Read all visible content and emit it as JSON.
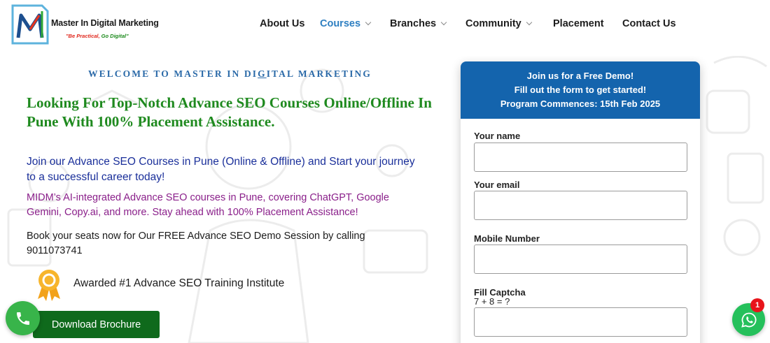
{
  "brand": {
    "name": "Master In Digital Marketing",
    "tagline_red": "\"Be Practical,",
    "tagline_green": " Go Digital\"",
    "colors": {
      "primary_blue": "#1464ad",
      "green": "#1f8a1f",
      "purple": "#8a1f8a"
    }
  },
  "nav": {
    "items": [
      {
        "label": "About Us"
      },
      {
        "label": "Courses"
      },
      {
        "label": "Branches"
      },
      {
        "label": "Community"
      },
      {
        "label": "Placement"
      },
      {
        "label": "Contact Us"
      }
    ]
  },
  "hero": {
    "welcome_pre": "WELCOME TO MASTER IN DI",
    "welcome_mid": "G",
    "welcome_post": "ITAL MARKETING",
    "headline": "Looking For Top-Notch Advance SEO Courses Online/Offline In Pune With 100% Placement Assistance.",
    "intro": "Join our Advance SEO Courses in Pune (Online & Offline) and Start your journey to a successful career today!",
    "ai_text": "MIDM’s AI-integrated Advance SEO courses in Pune, covering ChatGPT, Google Gemini, Copy.ai, and more. Stay ahead with 100% Placement Assistance!",
    "book_text": "Book your seats now for Our FREE Advance SEO Demo Session by calling 9011073741",
    "award": "Awarded #1 Advance SEO Training Institute",
    "download_label": "Download Brochure"
  },
  "form": {
    "header_line1": "Join us for a Free Demo!",
    "header_line2": "Fill out the form to get started!",
    "header_line3": "Program Commences: 15th Feb 2025",
    "name_label": "Your name",
    "email_label": "Your email",
    "mobile_label": "Mobile Number",
    "captcha_label": "Fill Captcha",
    "captcha_question": "7 + 8 = ?",
    "name_value": "",
    "email_value": "",
    "mobile_value": "",
    "captcha_value": ""
  },
  "whatsapp": {
    "badge": "1"
  },
  "icons": [
    "logo-m-icon",
    "chevron-down-icon",
    "award-ribbon-icon",
    "phone-icon",
    "whatsapp-icon"
  ]
}
